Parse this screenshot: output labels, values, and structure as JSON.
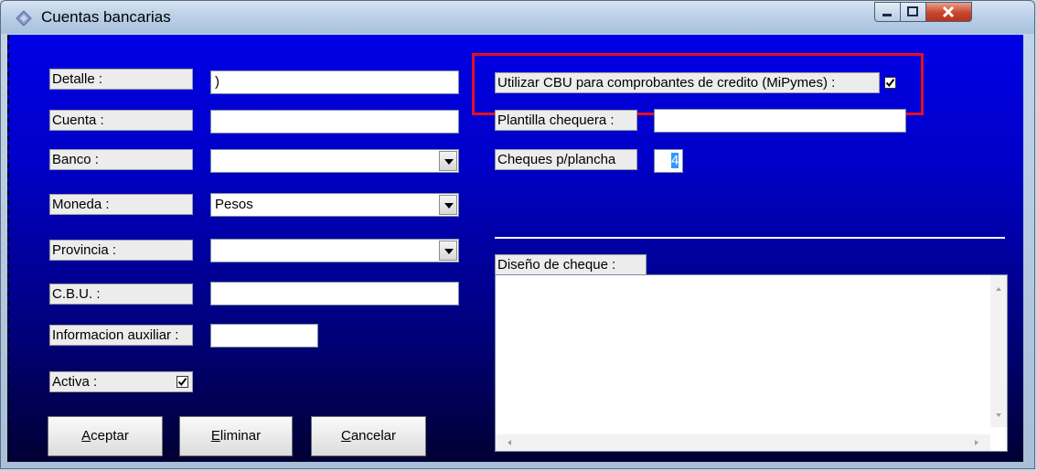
{
  "window": {
    "title": "Cuentas bancarias"
  },
  "labels": {
    "detalle": "Detalle :",
    "cuenta": "Cuenta :",
    "banco": "Banco :",
    "moneda": "Moneda :",
    "provincia": "Provincia  :",
    "cbu": "C.B.U. :",
    "info_aux": "Informacion auxiliar :",
    "activa": "Activa :",
    "utilizar_cbu": "Utilizar CBU para comprobantes de credito (MiPymes) :",
    "plantilla": "Plantilla chequera :",
    "cheques": "Cheques p/plancha",
    "diseno": "Diseño de cheque :"
  },
  "fields": {
    "detalle": ")",
    "cuenta": "",
    "banco": "",
    "moneda": "Pesos",
    "provincia": "",
    "cbu": "",
    "info_aux": "",
    "plantilla": "",
    "cheques": "4",
    "diseno": ""
  },
  "checks": {
    "activa": true,
    "utilizar_cbu": true
  },
  "buttons": {
    "aceptar_u": "A",
    "aceptar_rest": "ceptar",
    "eliminar_u": "E",
    "eliminar_rest": "liminar",
    "cancelar_u": "C",
    "cancelar_rest": "ancelar"
  },
  "colors": {
    "highlight_box": "#e01020",
    "client_gradient_top": "#0000e6",
    "client_gradient_bottom": "#000033"
  },
  "icons": {
    "app": "diamond-app-icon",
    "minimize": "minimize-icon",
    "maximize": "maximize-icon",
    "close": "close-icon"
  }
}
